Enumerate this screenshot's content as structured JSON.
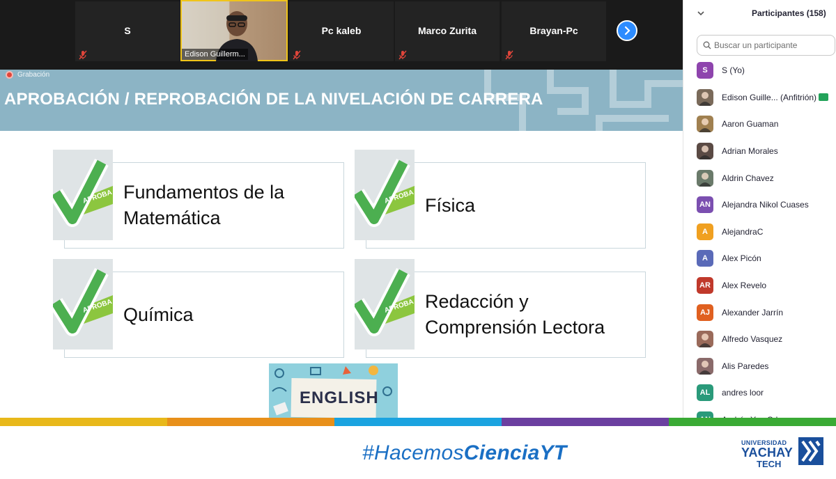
{
  "video_strip": {
    "tiles": [
      {
        "name": "S"
      },
      {
        "name": "Edison Guillerm..."
      },
      {
        "name": "Pc kaleb"
      },
      {
        "name": "Marco Zurita"
      },
      {
        "name": "Brayan-Pc"
      }
    ],
    "next_page_icon": "chevron-right-icon"
  },
  "slide": {
    "recording_label": "Grabación",
    "title": "APROBACIÓN / REPROBACIÓN DE LA NIVELACIÓN DE CARRERA",
    "badge_text": "APROBA",
    "cards": [
      {
        "label": "Fundamentos de la\nMatemática"
      },
      {
        "label": "Física"
      },
      {
        "label": "Química"
      },
      {
        "label": "Redacción y\nComprensión Lectora"
      }
    ],
    "english_label": "ENGLISH"
  },
  "footer": {
    "hashtag_prefix": "#Hacemos",
    "hashtag_bold": "CienciaYT",
    "logo_line1": "UNIVERSIDAD",
    "logo_line2": "YACHAY",
    "logo_line3": "TECH",
    "stripe_colors": [
      "#e8b81a",
      "#e8901a",
      "#1aa3e0",
      "#6b3fa0",
      "#3aaa35"
    ]
  },
  "panel": {
    "title": "Participantes (158)",
    "search_placeholder": "Buscar un participante",
    "participants": [
      {
        "name": "S (Yo)",
        "initials": "S",
        "color": "#8e44ad",
        "photo": false,
        "host": false
      },
      {
        "name": "Edison Guille...  (Anfitrión)",
        "initials": "",
        "color": "#7a6a5a",
        "photo": true,
        "host": true
      },
      {
        "name": "Aaron Guaman",
        "initials": "",
        "color": "#a08050",
        "photo": true,
        "host": false
      },
      {
        "name": "Adrian Morales",
        "initials": "",
        "color": "#5a4a44",
        "photo": true,
        "host": false
      },
      {
        "name": "Aldrin Chavez",
        "initials": "",
        "color": "#6a7a6a",
        "photo": true,
        "host": false
      },
      {
        "name": "Alejandra Nikol Cuases",
        "initials": "AN",
        "color": "#7b4fb0",
        "photo": false,
        "host": false
      },
      {
        "name": "AlejandraC",
        "initials": "A",
        "color": "#f0a020",
        "photo": false,
        "host": false
      },
      {
        "name": "Alex Picón",
        "initials": "A",
        "color": "#5a6ab8",
        "photo": false,
        "host": false
      },
      {
        "name": "Alex Revelo",
        "initials": "AR",
        "color": "#c0392b",
        "photo": false,
        "host": false
      },
      {
        "name": "Alexander Jarrín",
        "initials": "AJ",
        "color": "#e06020",
        "photo": false,
        "host": false
      },
      {
        "name": "Alfredo Vasquez",
        "initials": "",
        "color": "#9a6a5a",
        "photo": true,
        "host": false
      },
      {
        "name": "Alis Paredes",
        "initials": "",
        "color": "#8a6a6a",
        "photo": true,
        "host": false
      },
      {
        "name": "andres loor",
        "initials": "AL",
        "color": "#2a9a7a",
        "photo": false,
        "host": false
      },
      {
        "name": "Andrés Yaa Cde...",
        "initials": "AN",
        "color": "#2a9a7a",
        "photo": false,
        "host": false
      }
    ]
  }
}
